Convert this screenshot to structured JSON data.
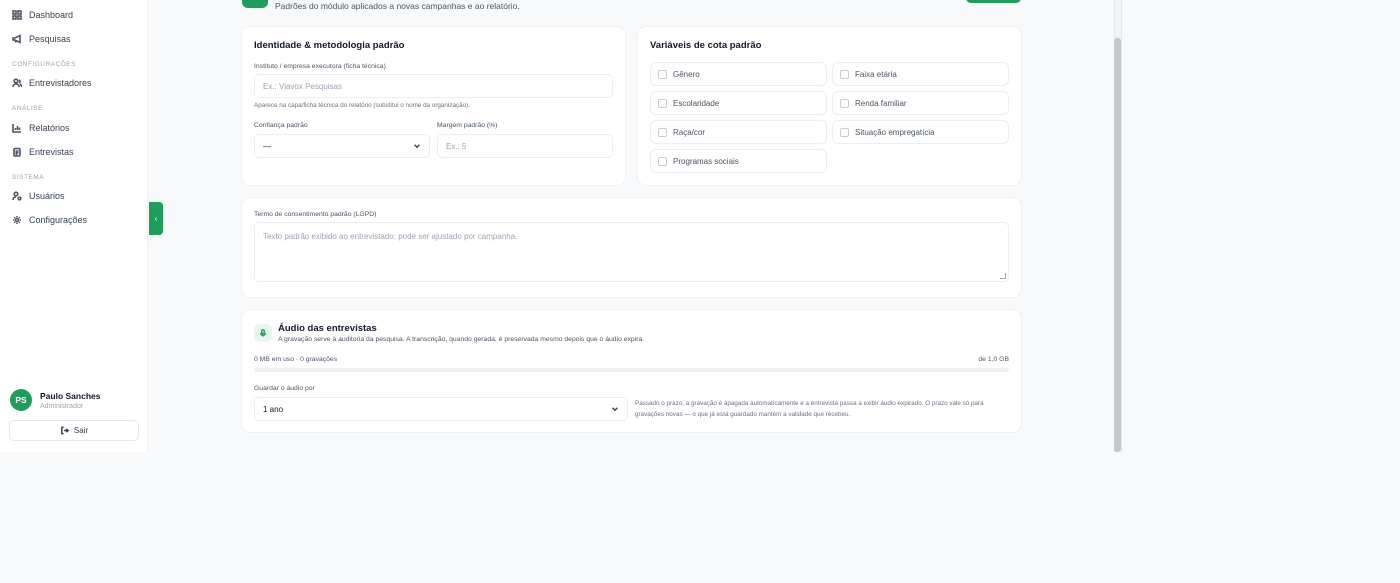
{
  "sidebar": {
    "items": [
      {
        "label": "Dashboard",
        "icon": "grid-icon"
      },
      {
        "label": "Pesquisas",
        "icon": "megaphone-icon"
      },
      {
        "label": "Entrevistadores",
        "icon": "users-icon"
      },
      {
        "label": "Relatórios",
        "icon": "bar-chart-icon"
      },
      {
        "label": "Entrevistas",
        "icon": "clipboard-icon"
      },
      {
        "label": "Usuários",
        "icon": "user-gear-icon"
      },
      {
        "label": "Configurações",
        "icon": "gear-icon"
      }
    ],
    "sections": {
      "configuracoes": "CONFIGURAÇÕES",
      "analise": "ANÁLISE",
      "sistema": "SISTEMA"
    },
    "user": {
      "initials": "PS",
      "name": "Paulo Sanches",
      "role": "Administrador"
    },
    "logout_label": "Sair"
  },
  "header": {
    "subtitle": "Padrões do módulo aplicados a novas campanhas e ao relatório."
  },
  "identity": {
    "title": "Identidade & metodologia padrão",
    "institute_label": "Instituto / empresa executora (ficha técnica)",
    "institute_placeholder": "Ex.: Viavox Pesquisas",
    "institute_hint": "Aparece na capa/ficha técnica do relatório (substitui o nome da organização).",
    "confidence_label": "Confiança padrão",
    "confidence_value": "—",
    "margin_label": "Margem padrão (%)",
    "margin_placeholder": "Ex.: 5"
  },
  "quota": {
    "title": "Variáveis de cota padrão",
    "options": [
      "Gênero",
      "Faixa etária",
      "Escolaridade",
      "Renda familiar",
      "Raça/cor",
      "Situação empregatícia",
      "Programas sociais"
    ]
  },
  "consent": {
    "label": "Termo de consentimento padrão (LGPD)",
    "placeholder": "Texto padrão exibido ao entrevistado; pode ser ajustado por campanha."
  },
  "audio": {
    "title": "Áudio das entrevistas",
    "subtitle": "A gravação serve à auditoria da pesquisa. A transcrição, quando gerada, é preservada mesmo depois que o áudio expira.",
    "usage": "0 MB em uso · 0 gravações",
    "capacity": "de 1,0 GB",
    "usage_fraction": 0,
    "keep_label": "Guardar o áudio por",
    "keep_value": "1 ano",
    "keep_hint": "Passado o prazo, a gravação é apagada automaticamente e a entrevista passa a exibir áudio expirado. O prazo vale só para gravações novas — o que já está guardado mantém a validade que recebeu."
  },
  "colors": {
    "accent": "#1f9d5c"
  }
}
